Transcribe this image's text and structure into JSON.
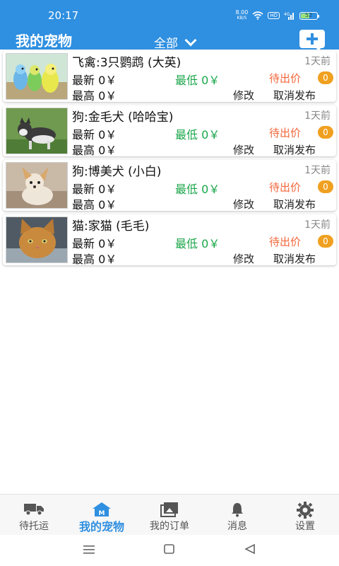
{
  "status_bar": {
    "time": "20:17",
    "net_speed_value": "8.00",
    "net_speed_unit": "KB/S",
    "hd_label": "HD",
    "signal_label": "4G",
    "battery_level": "52"
  },
  "header": {
    "title": "我的宠物",
    "filter_label": "全部",
    "add_icon": "add-message-icon"
  },
  "pets": [
    {
      "name": "飞禽:3只鹦鹉 (大英)",
      "time": "1天前",
      "latest": "最新 0￥",
      "lowest": "最低 0￥",
      "highest": "最高 0￥",
      "status": "待出价",
      "count": "0",
      "edit": "修改",
      "cancel": "取消发布",
      "image": "parrots"
    },
    {
      "name": "狗:金毛犬 (哈哈宝)",
      "time": "1天前",
      "latest": "最新 0￥",
      "lowest": "最低 0￥",
      "highest": "最高 0￥",
      "status": "待出价",
      "count": "0",
      "edit": "修改",
      "cancel": "取消发布",
      "image": "husky-puppy"
    },
    {
      "name": "狗:博美犬 (小白)",
      "time": "1天前",
      "latest": "最新 0￥",
      "lowest": "最低 0￥",
      "highest": "最高 0￥",
      "status": "待出价",
      "count": "0",
      "edit": "修改",
      "cancel": "取消发布",
      "image": "chihuahua"
    },
    {
      "name": "猫:家猫 (毛毛)",
      "time": "1天前",
      "latest": "最新 0￥",
      "lowest": "最低 0￥",
      "highest": "最高 0￥",
      "status": "待出价",
      "count": "0",
      "edit": "修改",
      "cancel": "取消发布",
      "image": "tabby-cat"
    }
  ],
  "bottom_nav": [
    {
      "label": "待托运",
      "icon": "truck-icon"
    },
    {
      "label": "我的宠物",
      "icon": "home-m-icon",
      "active": true
    },
    {
      "label": "我的订单",
      "icon": "photos-icon"
    },
    {
      "label": "消息",
      "icon": "bell-icon"
    },
    {
      "label": "设置",
      "icon": "gear-icon"
    }
  ],
  "colors": {
    "primary": "#2f8fe0",
    "low_price": "#1aa64a",
    "status": "#f2663a",
    "badge": "#f0a020"
  }
}
